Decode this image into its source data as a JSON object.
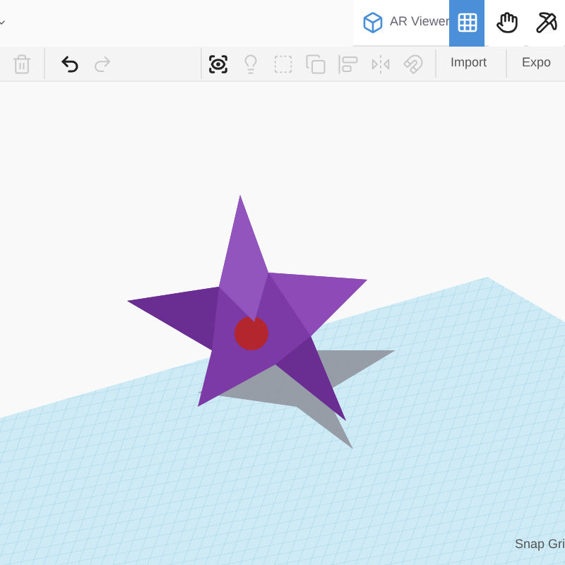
{
  "header": {
    "ar_viewer": {
      "label": "AR Viewer"
    },
    "view_buttons": [
      {
        "kind": "grid",
        "selected": true
      },
      {
        "kind": "hand",
        "selected": false
      },
      {
        "kind": "pickaxe",
        "selected": false
      }
    ]
  },
  "toolbar": {
    "tools": [
      {
        "kind": "trash",
        "disabled": true
      },
      {
        "kind": "undo",
        "disabled": false
      },
      {
        "kind": "redo",
        "disabled": true
      },
      {
        "kind": "view",
        "disabled": false
      },
      {
        "kind": "bulb",
        "disabled": true
      },
      {
        "kind": "group",
        "disabled": true
      },
      {
        "kind": "ungroup",
        "disabled": true
      },
      {
        "kind": "align",
        "disabled": true
      },
      {
        "kind": "mirror",
        "disabled": true
      },
      {
        "kind": "magnet",
        "disabled": true
      }
    ],
    "buttons": [
      "Import",
      "Expo"
    ]
  },
  "footer": {
    "snap_grid": "Snap Gri"
  }
}
